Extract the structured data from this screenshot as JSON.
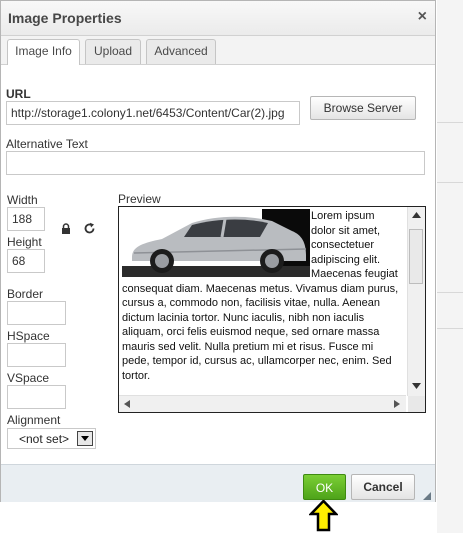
{
  "dialog": {
    "title": "Image Properties",
    "close_symbol": "×"
  },
  "tabs": [
    {
      "label": "Image Info",
      "active": true
    },
    {
      "label": "Upload",
      "active": false
    },
    {
      "label": "Advanced",
      "active": false
    }
  ],
  "url": {
    "label": "URL",
    "value": "http://storage1.colony1.net/6453/Content/Car(2).jpg",
    "browse_label": "Browse Server"
  },
  "alt_text": {
    "label": "Alternative Text",
    "value": ""
  },
  "size": {
    "width_label": "Width",
    "width_value": "188",
    "height_label": "Height",
    "height_value": "68",
    "lock_icon": "lock-icon",
    "reset_icon": "reset-size-icon"
  },
  "spacing": {
    "border_label": "Border",
    "border_value": "",
    "hspace_label": "HSpace",
    "hspace_value": "",
    "vspace_label": "VSpace",
    "vspace_value": ""
  },
  "alignment": {
    "label": "Alignment",
    "selected": "<not set>"
  },
  "preview": {
    "label": "Preview",
    "image_alt": "silver sedan car",
    "text": "Lorem ipsum dolor sit amet, consectetuer adipiscing elit. Maecenas feugiat consequat diam. Maecenas metus. Vivamus diam purus, cursus a, commodo non, facilisis vitae, nulla. Aenean dictum lacinia tortor. Nunc iaculis, nibh non iaculis aliquam, orci felis euismod neque, sed ornare massa mauris sed velit. Nulla pretium mi et risus. Fusce mi pede, tempor id, cursus ac, ullamcorper nec, enim. Sed tortor."
  },
  "footer": {
    "ok_label": "OK",
    "cancel_label": "Cancel"
  },
  "colors": {
    "ok_green": "#5cb31a",
    "arrow_yellow": "#ffee00",
    "title_text": "#474747"
  }
}
